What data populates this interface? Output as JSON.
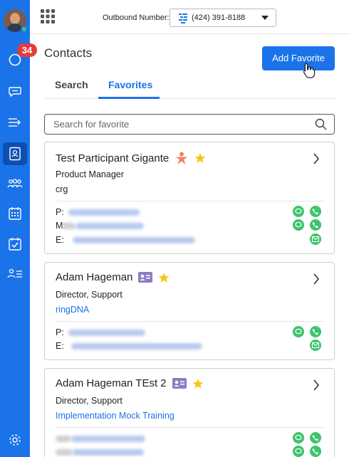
{
  "header": {
    "outbound_label": "Outbound Number:",
    "outbound_number": "(424) 391-8188"
  },
  "sidebar": {
    "notification_count": "34",
    "items": [
      "activity",
      "messages",
      "transfers",
      "contacts",
      "teams",
      "calendar",
      "tasks",
      "user-list",
      "settings"
    ]
  },
  "page": {
    "title": "Contacts",
    "add_favorite_label": "Add Favorite"
  },
  "tabs": [
    {
      "label": "Search",
      "active": false
    },
    {
      "label": "Favorites",
      "active": true
    }
  ],
  "search": {
    "placeholder": "Search for favorite"
  },
  "contacts": [
    {
      "name": "Test Participant Gigante",
      "title": "Product Manager",
      "company": "crg",
      "company_is_link": false,
      "type_icon": "person-star-icon",
      "fields": [
        "P:",
        "M:",
        "E:"
      ]
    },
    {
      "name": "Adam Hageman",
      "title": "Director, Support",
      "company": "ringDNA",
      "company_is_link": true,
      "type_icon": "contact-card-icon",
      "fields": [
        "P:",
        "E:"
      ]
    },
    {
      "name": "Adam Hageman TEst 2",
      "title": "Director, Support",
      "company": "Implementation Mock Training",
      "company_is_link": true,
      "type_icon": "contact-card-icon",
      "fields": [
        "P:",
        "M:"
      ]
    }
  ],
  "colors": {
    "brand_blue": "#1a73e8",
    "action_green": "#3ec46d",
    "badge_red": "#e63b3b",
    "favorite_star": "#f5c518",
    "person_icon": "#e8845c"
  }
}
